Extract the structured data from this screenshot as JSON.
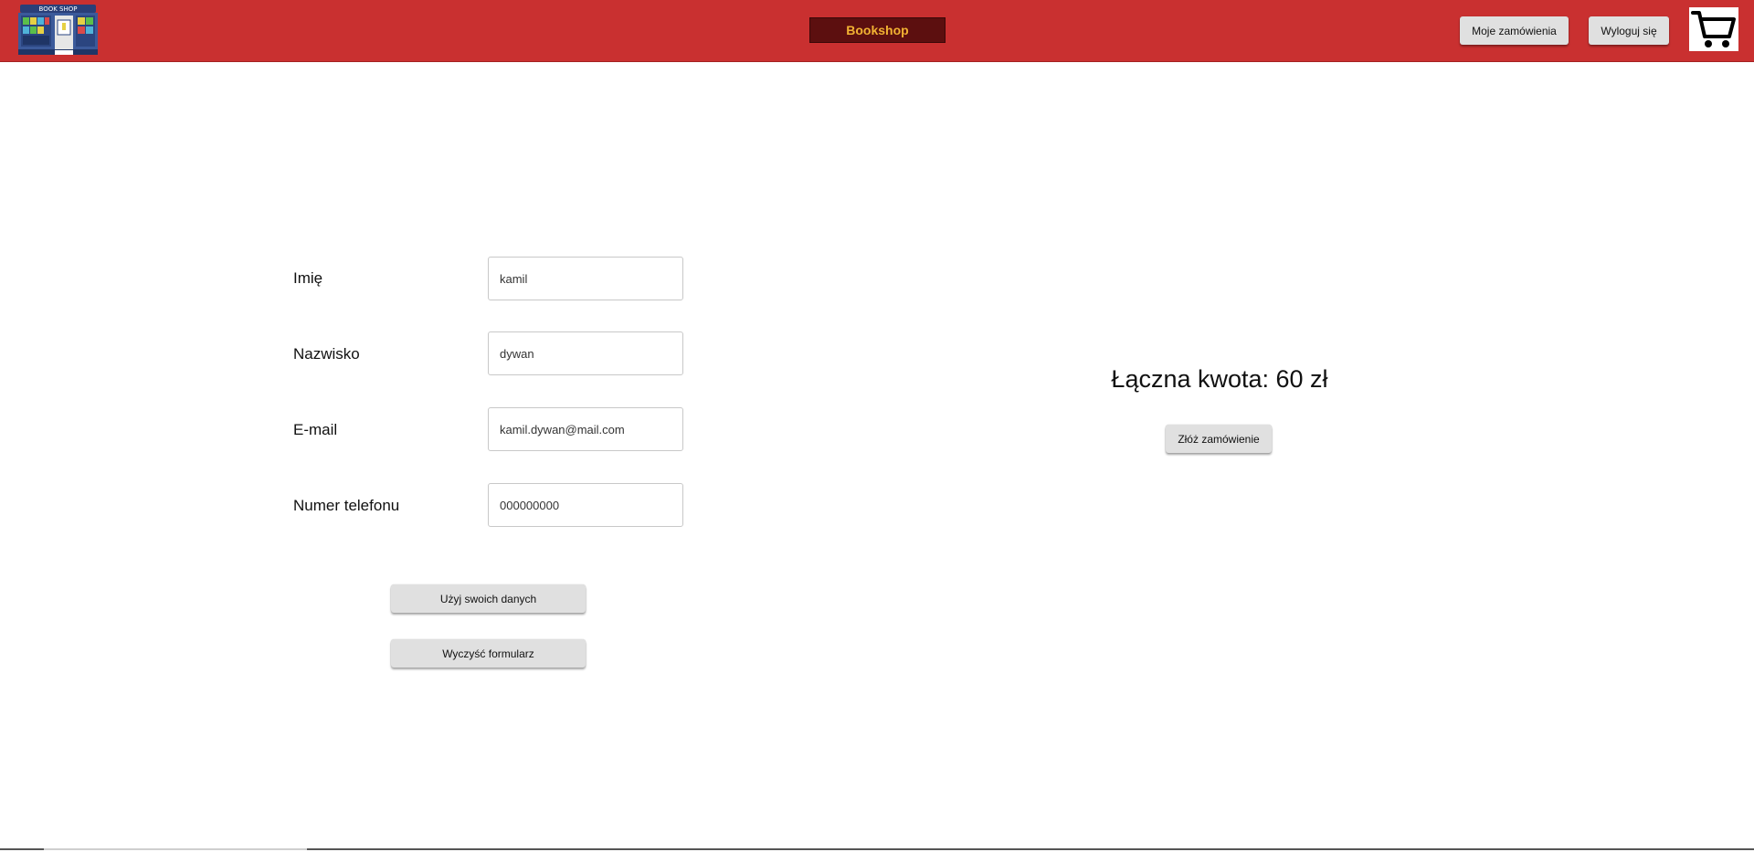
{
  "header": {
    "logo_text": "BOOK SHOP",
    "brand": "Bookshop",
    "my_orders_label": "Moje zamówienia",
    "logout_label": "Wyloguj się",
    "cart_icon": "cart-icon",
    "background_color": "#c93030",
    "brand_bg_color": "#5c0f0f",
    "brand_text_color": "#f2b233"
  },
  "form": {
    "fields": [
      {
        "label": "Imię",
        "value": "kamil"
      },
      {
        "label": "Nazwisko",
        "value": "dywan"
      },
      {
        "label": "E-mail",
        "value": "kamil.dywan@mail.com"
      },
      {
        "label": "Numer telefonu",
        "value": "000000000"
      }
    ],
    "use_my_data_label": "Użyj swoich danych",
    "clear_form_label": "Wyczyść formularz"
  },
  "summary": {
    "total_text": "Łączna kwota: 60 zł",
    "place_order_label": "Złóż zamówienie"
  }
}
